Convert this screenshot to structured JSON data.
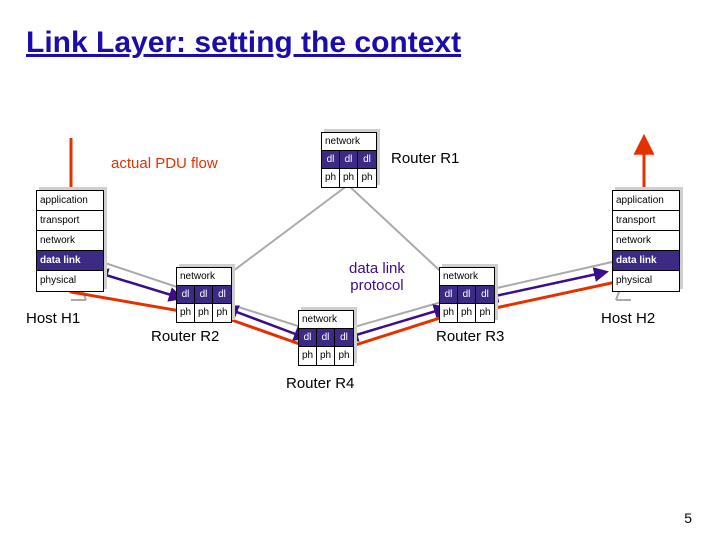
{
  "title": "Link Layer: setting the context",
  "page_number": "5",
  "annotations": {
    "pdu_flow": "actual PDU flow",
    "dl_protocol": "data link\nprotocol"
  },
  "host_layers": [
    "application",
    "transport",
    "network",
    "data link",
    "physical"
  ],
  "router_rows": {
    "network": "network",
    "dl": "dl",
    "ph": "ph"
  },
  "nodes": {
    "h1": "Host H1",
    "h2": "Host H2",
    "r1": "Router R1",
    "r2": "Router R2",
    "r3": "Router R3",
    "r4": "Router R4"
  }
}
